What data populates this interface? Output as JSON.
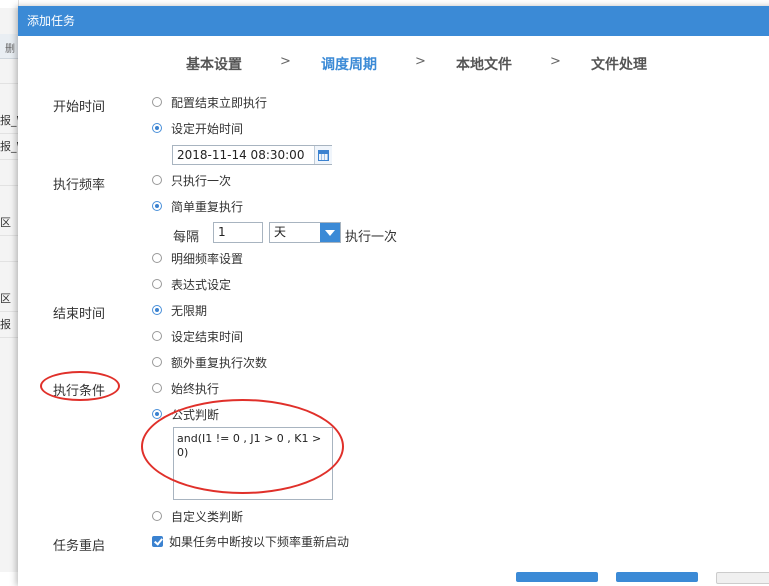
{
  "background": {
    "header_fragment": "删",
    "rows": [
      {
        "text": ""
      },
      {
        "text": "报_W"
      },
      {
        "text": "报_W"
      },
      {
        "text": ""
      },
      {
        "text": "区"
      },
      {
        "text": ""
      },
      {
        "text": "区"
      },
      {
        "text": "报"
      }
    ]
  },
  "dialog": {
    "title": "添加任务",
    "steps": [
      "基本设置",
      "调度周期",
      "本地文件",
      "文件处理"
    ],
    "step_separator": ">",
    "active_step_index": 1
  },
  "form": {
    "start_time": {
      "label": "开始时间",
      "options": [
        "配置结束立即执行",
        "设定开始时间"
      ],
      "selected": 1,
      "datetime_value": "2018-11-14 08:30:00"
    },
    "frequency": {
      "label": "执行频率",
      "options": [
        "只执行一次",
        "简单重复执行",
        "明细频率设置",
        "表达式设定"
      ],
      "selected": 1,
      "every_label": "每隔",
      "interval_value": "1",
      "unit_value": "天",
      "suffix": "执行一次"
    },
    "end_time": {
      "label": "结束时间",
      "options": [
        "无限期",
        "设定结束时间",
        "额外重复执行次数"
      ],
      "selected": 0
    },
    "condition": {
      "label": "执行条件",
      "options": [
        "始终执行",
        "公式判断",
        "自定义类判断"
      ],
      "selected": 1,
      "formula": "and(I1 != 0 , J1 > 0 , K1 > 0)"
    },
    "restart": {
      "label": "任务重启",
      "checkbox_label": "如果任务中断按以下频率重新启动",
      "checked": true
    }
  },
  "colors": {
    "accent": "#3b8ad6",
    "annotation": "#e0302a"
  }
}
